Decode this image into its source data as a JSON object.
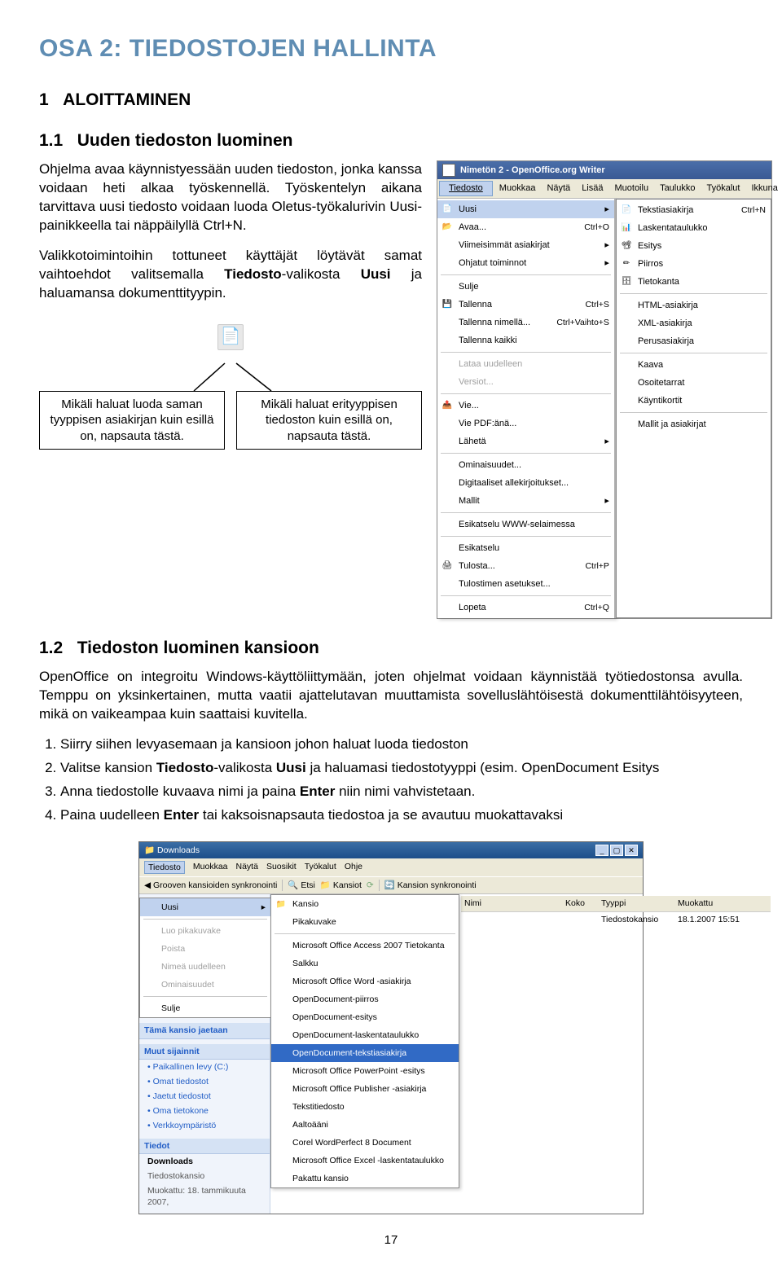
{
  "title": "OSA 2: TIEDOSTOJEN HALLINTA",
  "h1": "1   ALOITTAMINEN",
  "h2_1": "1.1   Uuden tiedoston luominen",
  "para1": "Ohjelma avaa käynnistyessään uuden tiedoston, jonka kanssa voidaan heti alkaa työskennellä. Työskentelyn aikana tarvittava uusi tiedosto voidaan luoda Oletus-työkalurivin Uusi-painikkeella tai näppäilyllä Ctrl+N.",
  "para2_a": "Valikkotoimintoihin tottuneet käyttäjät löytävät samat vaihtoehdot valitsemalla ",
  "para2_b": "Tiedosto",
  "para2_c": "-valikosta ",
  "para2_d": "Uusi",
  "para2_e": " ja haluamansa dokumenttityypin.",
  "callout_left": "Mikäli haluat luoda saman tyyppisen asiakirjan kuin esillä on, napsauta tästä.",
  "callout_right": "Mikäli haluat erityyppisen tiedoston kuin esillä on, napsauta tästä.",
  "h2_2": "1.2   Tiedoston luominen kansioon",
  "para3": "OpenOffice on integroitu Windows-käyttöliittymään, joten ohjelmat voidaan käynnistää työtiedostonsa avulla. Temppu on yksinkertainen, mutta vaatii ajattelutavan muuttamista sovelluslähtöisestä dokumenttilähtöisyyteen, mikä on vaikeampaa kuin saattaisi kuvitella.",
  "steps": {
    "s1": "Siirry siihen levyasemaan ja kansioon johon haluat luoda tiedoston",
    "s2a": "Valitse kansion ",
    "s2b": "Tiedosto",
    "s2c": "-valikosta ",
    "s2d": "Uusi",
    "s2e": " ja haluamasi tiedostotyyppi (esim. OpenDocument Esitys",
    "s3a": "Anna tiedostolle kuvaava nimi ja paina ",
    "s3b": "Enter",
    "s3c": " niin nimi vahvistetaan.",
    "s4a": "Paina uudelleen ",
    "s4b": "Enter",
    "s4c": " tai kaksoisnapsauta tiedostoa ja se avautuu muokattavaksi"
  },
  "page_number": "17",
  "shot1": {
    "title": "Nimetön 2 - OpenOffice.org Writer",
    "menus": [
      "Tiedosto",
      "Muokkaa",
      "Näytä",
      "Lisää",
      "Muotoilu",
      "Taulukko",
      "Työkalut",
      "Ikkuna"
    ],
    "file_items": [
      {
        "icon": "📄",
        "label": "Uusi",
        "shortcut": "",
        "arrow": "▸",
        "sel": true
      },
      {
        "icon": "📂",
        "label": "Avaa...",
        "shortcut": "Ctrl+O"
      },
      {
        "icon": "",
        "label": "Viimeisimmät asiakirjat",
        "arrow": "▸"
      },
      {
        "icon": "",
        "label": "Ohjatut toiminnot",
        "arrow": "▸"
      },
      {
        "sep": true
      },
      {
        "icon": "",
        "label": "Sulje"
      },
      {
        "icon": "💾",
        "label": "Tallenna",
        "shortcut": "Ctrl+S"
      },
      {
        "icon": "",
        "label": "Tallenna nimellä...",
        "shortcut": "Ctrl+Vaihto+S"
      },
      {
        "icon": "",
        "label": "Tallenna kaikki"
      },
      {
        "sep": true
      },
      {
        "icon": "",
        "label": "Lataa uudelleen",
        "dim": true
      },
      {
        "icon": "",
        "label": "Versiot...",
        "dim": true
      },
      {
        "sep": true
      },
      {
        "icon": "📤",
        "label": "Vie..."
      },
      {
        "icon": "",
        "label": "Vie PDF:änä..."
      },
      {
        "icon": "",
        "label": "Lähetä",
        "arrow": "▸"
      },
      {
        "sep": true
      },
      {
        "icon": "",
        "label": "Ominaisuudet..."
      },
      {
        "icon": "",
        "label": "Digitaaliset allekirjoitukset..."
      },
      {
        "icon": "",
        "label": "Mallit",
        "arrow": "▸"
      },
      {
        "sep": true
      },
      {
        "icon": "",
        "label": "Esikatselu WWW-selaimessa"
      },
      {
        "sep": true
      },
      {
        "icon": "",
        "label": "Esikatselu"
      },
      {
        "icon": "🖨",
        "label": "Tulosta...",
        "shortcut": "Ctrl+P"
      },
      {
        "icon": "",
        "label": "Tulostimen asetukset..."
      },
      {
        "sep": true
      },
      {
        "icon": "",
        "label": "Lopeta",
        "shortcut": "Ctrl+Q"
      }
    ],
    "new_sub": [
      {
        "icon": "📄",
        "label": "Tekstiasiakirja",
        "shortcut": "Ctrl+N"
      },
      {
        "icon": "📊",
        "label": "Laskentataulukko"
      },
      {
        "icon": "📽",
        "label": "Esitys"
      },
      {
        "icon": "✏",
        "label": "Piirros"
      },
      {
        "icon": "🗄",
        "label": "Tietokanta"
      },
      {
        "sep": true
      },
      {
        "icon": "",
        "label": "HTML-asiakirja"
      },
      {
        "icon": "",
        "label": "XML-asiakirja"
      },
      {
        "icon": "",
        "label": "Perusasiakirja"
      },
      {
        "sep": true
      },
      {
        "icon": "",
        "label": "Kaava"
      },
      {
        "icon": "",
        "label": "Osoitetarrat"
      },
      {
        "icon": "",
        "label": "Käyntikortit"
      },
      {
        "sep": true
      },
      {
        "icon": "",
        "label": "Mallit ja asiakirjat"
      }
    ]
  },
  "shot2": {
    "win_title": "Downloads",
    "menus": [
      "Tiedosto",
      "Muokkaa",
      "Näytä",
      "Suosikit",
      "Työkalut",
      "Ohje"
    ],
    "toolbar": [
      "Grooven kansioiden synkronointi",
      "Etsi",
      "Kansiot",
      "Kansion synkronointi"
    ],
    "ctx_items": [
      {
        "label": "Uusi",
        "arrow": "▸",
        "sel": true
      },
      {
        "sep": true
      },
      {
        "label": "Luo pikakuvake",
        "dim": true
      },
      {
        "label": "Poista",
        "dim": true
      },
      {
        "label": "Nimeä uudelleen",
        "dim": true
      },
      {
        "label": "Ominaisuudet",
        "dim": true
      },
      {
        "sep": true
      },
      {
        "label": "Sulje"
      }
    ],
    "new_items": [
      {
        "icon": "📁",
        "label": "Kansio"
      },
      {
        "icon": "",
        "label": "Pikakuvake"
      },
      {
        "sep": true
      },
      {
        "icon": "",
        "label": "Microsoft Office Access 2007 Tietokanta"
      },
      {
        "icon": "",
        "label": "Salkku"
      },
      {
        "icon": "",
        "label": "Microsoft Office Word -asiakirja"
      },
      {
        "icon": "",
        "label": "OpenDocument-piirros"
      },
      {
        "icon": "",
        "label": "OpenDocument-esitys"
      },
      {
        "icon": "",
        "label": "OpenDocument-laskentataulukko"
      },
      {
        "icon": "",
        "label": "OpenDocument-tekstiasiakirja",
        "hl": true
      },
      {
        "icon": "",
        "label": "Microsoft Office PowerPoint -esitys"
      },
      {
        "icon": "",
        "label": "Microsoft Office Publisher -asiakirja"
      },
      {
        "icon": "",
        "label": "Tekstitiedosto"
      },
      {
        "icon": "",
        "label": "Aaltoääni"
      },
      {
        "icon": "",
        "label": "Corel WordPerfect 8 Document"
      },
      {
        "icon": "",
        "label": "Microsoft Office Excel -laskentataulukko"
      },
      {
        "icon": "",
        "label": "Pakattu kansio"
      }
    ],
    "left_panels": {
      "tasks_header": "Tämä kansio jaetaan",
      "locations_header": "Muut sijainnit",
      "locations": [
        "Paikallinen levy (C:)",
        "Omat tiedostot",
        "Jaetut tiedostot",
        "Oma tietokone",
        "Verkkoympäristö"
      ],
      "details_header": "Tiedot",
      "details": [
        "Downloads",
        "Tiedostokansio",
        "Muokattu: 18. tammikuuta 2007,"
      ]
    },
    "cols": [
      "Nimi",
      "Koko",
      "Tyyppi",
      "Muokattu"
    ],
    "row": {
      "name": "",
      "type": "Tiedostokansio",
      "date": "18.1.2007 15:51"
    }
  }
}
